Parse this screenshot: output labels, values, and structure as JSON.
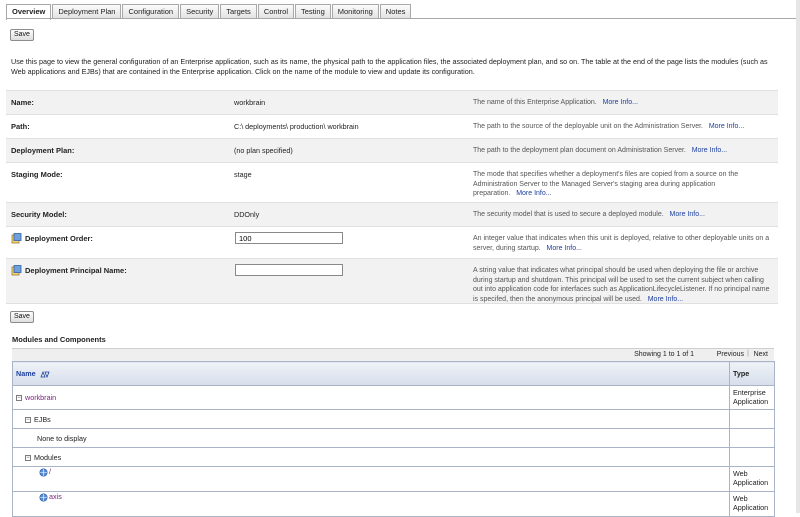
{
  "tabs": [
    "Overview",
    "Deployment Plan",
    "Configuration",
    "Security",
    "Targets",
    "Control",
    "Testing",
    "Monitoring",
    "Notes"
  ],
  "save_label": "Save",
  "intro": "Use this page to view the general configuration of an Enterprise application, such as its name, the physical path to the application files, the associated deployment plan, and so on. The table at the end of the page lists the modules (such as Web applications and EJBs) that are contained in the Enterprise application. Click on the name of the module to view and update its configuration.",
  "more_info": "More Info...",
  "fields": {
    "name": {
      "label": "Name:",
      "value": "workbrain",
      "desc": "The name of this Enterprise Application."
    },
    "path": {
      "label": "Path:",
      "value": "C:\\ deployments\\ production\\ workbrain",
      "desc": "The path to the source of the deployable unit on the Administration Server."
    },
    "plan": {
      "label": "Deployment Plan:",
      "value": "(no plan specified)",
      "desc": "The path to the deployment plan document on Administration Server."
    },
    "staging": {
      "label": "Staging Mode:",
      "value": "stage",
      "desc": "The mode that specifies whether a deployment's files are copied from a source on the Administration Server to the Managed Server's staging area during application preparation."
    },
    "security": {
      "label": "Security Model:",
      "value": "DDOnly",
      "desc": "The security model that is used to secure a deployed module."
    },
    "order": {
      "label": "Deployment Order:",
      "value": "100",
      "desc": "An integer value that indicates when this unit is deployed, relative to other deployable units on a server, during startup."
    },
    "principal": {
      "label": "Deployment Principal Name:",
      "value": "",
      "desc": "A string value that indicates what principal should be used when deploying the file or archive during startup and shutdown. This principal will be used to set the current subject when calling out into application code for interfaces such as ApplicationLifecycleListener. If no principal name is specifed, then the anonymous principal will be used."
    }
  },
  "modules": {
    "title": "Modules and Components",
    "showing": "Showing 1 to 1 of 1",
    "prev": "Previous",
    "sep": "|",
    "next": "Next",
    "col_name": "Name",
    "col_type": "Type",
    "app_name": "workbrain",
    "app_type": "Enterprise Application",
    "ejbs": "EJBs",
    "none": "None to display",
    "modules_label": "Modules",
    "mod1": "/",
    "mod1_type": "Web Application",
    "mod2": "axis",
    "mod2_type": "Web Application"
  },
  "colors": {
    "link": "#1d3f9e",
    "app_link": "#7a1e7a",
    "header_bg": "#d7deea"
  }
}
